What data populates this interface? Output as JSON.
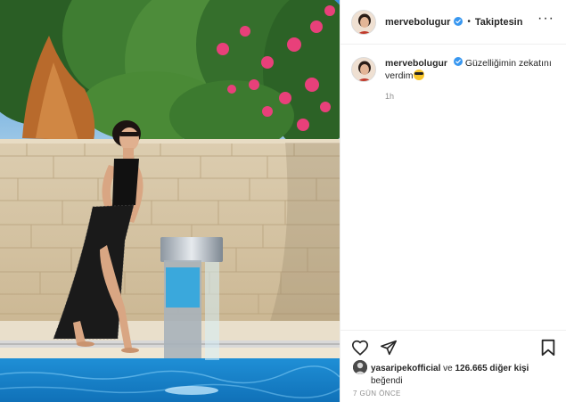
{
  "post": {
    "image_alt": "",
    "author": {
      "username": "mervebolugur",
      "verified": true,
      "avatar_icon": "avatar-icon"
    },
    "follow_separator": "•",
    "follow_label": "Takiptesin",
    "more_label": "···",
    "caption": {
      "username": "mervebolugur",
      "text": "Güzelliğimin zekatını verdim",
      "emoji": "sunglasses-emoji"
    },
    "time_label": "1h",
    "actions": {
      "like_icon": "heart-icon",
      "share_icon": "send-icon",
      "save_icon": "bookmark-icon"
    },
    "likes": {
      "liker": "yasaripekofficial",
      "connector": "ve",
      "count": "126.665 diğer kişi",
      "suffix": "beğendi"
    },
    "posted_ago": "7 GÜN ÖNCE"
  },
  "colors": {
    "verified_blue": "#3897f0",
    "text": "#262626",
    "muted": "#8e8e8e",
    "border": "#efefef",
    "pool": "#1f8fd6",
    "flowers": "#e8407a"
  }
}
